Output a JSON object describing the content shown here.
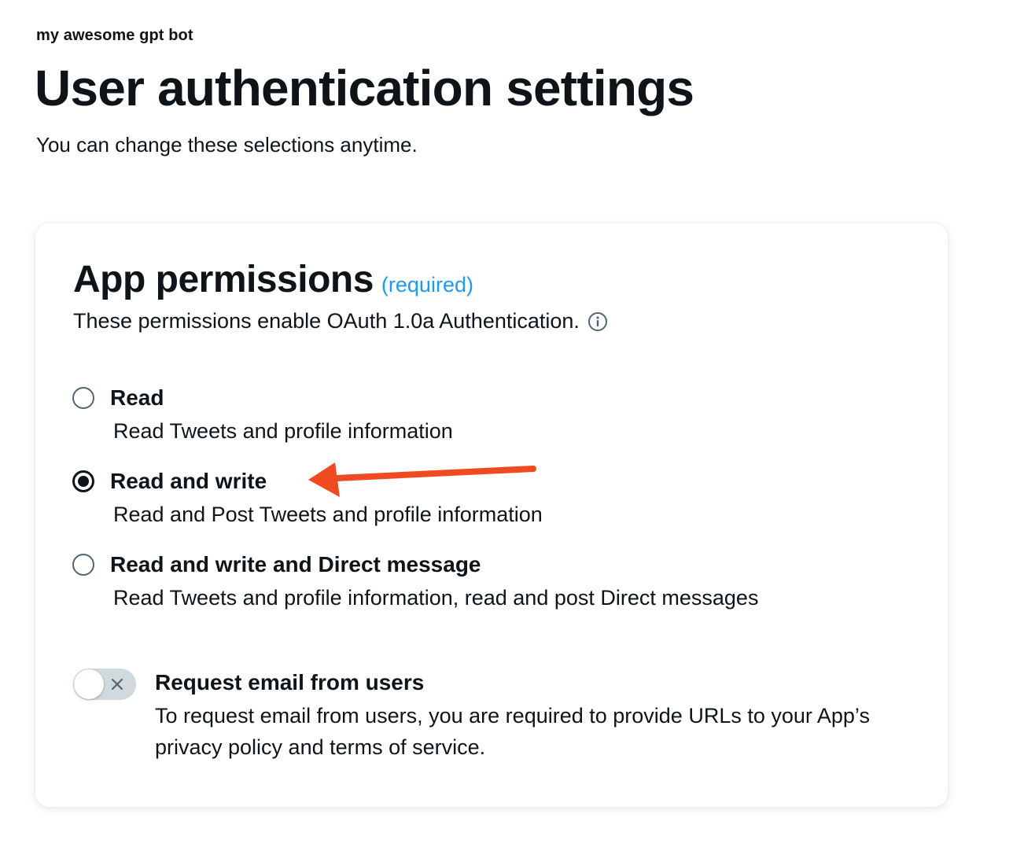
{
  "header": {
    "app_name": "my awesome gpt bot",
    "title": "User authentication settings",
    "subtitle": "You can change these selections anytime."
  },
  "card": {
    "title": "App permissions",
    "required_label": "(required)",
    "description": "These permissions enable OAuth 1.0a Authentication.",
    "info_icon": "info-circle-icon",
    "options": [
      {
        "label": "Read",
        "description": "Read Tweets and profile information",
        "selected": false
      },
      {
        "label": "Read and write",
        "description": "Read and Post Tweets and profile information",
        "selected": true
      },
      {
        "label": "Read and write and Direct message",
        "description": "Read Tweets and profile information, read and post Direct messages",
        "selected": false
      }
    ],
    "email_toggle": {
      "label": "Request email from users",
      "description": "To request email from users, you are required to provide URLs to your App’s privacy policy and terms of service.",
      "enabled": false,
      "icon": "close-icon"
    }
  },
  "annotation": {
    "icon": "arrow-left-icon",
    "color": "#f04a23"
  },
  "colors": {
    "text": "#0f1419",
    "accent": "#1d9bf0",
    "toggle_off": "#cfd9de",
    "radio_border": "#536471"
  }
}
